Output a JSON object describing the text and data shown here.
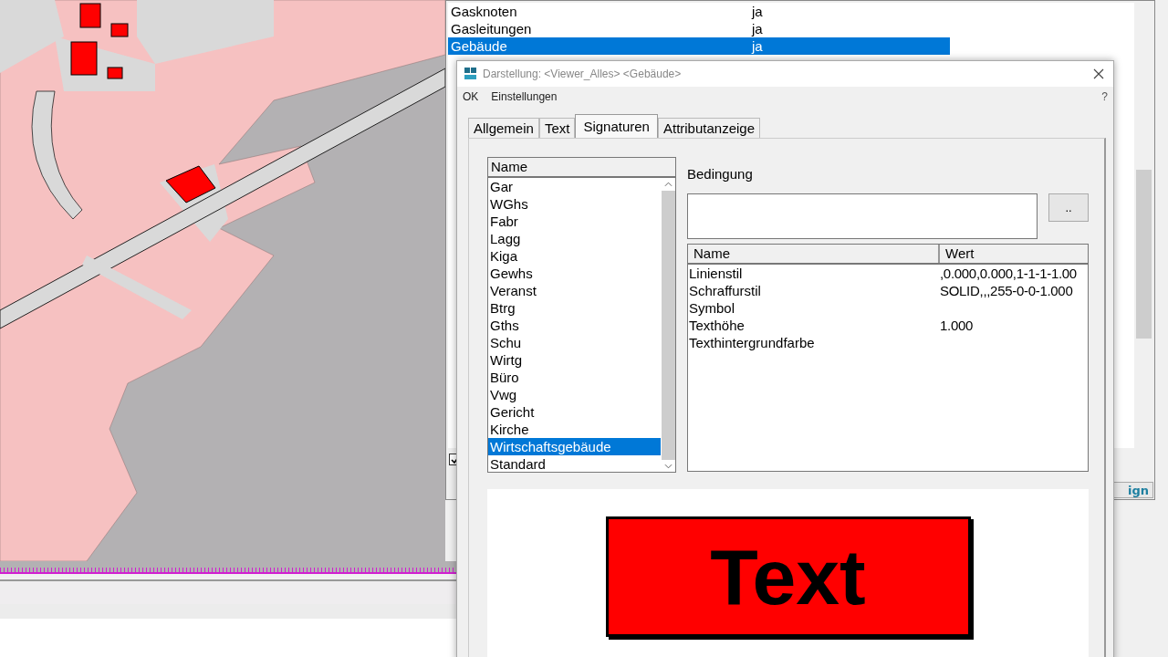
{
  "layer_list": {
    "rows": [
      {
        "name": "Gasknoten",
        "value": "ja",
        "selected": false
      },
      {
        "name": "Gasleitungen",
        "value": "ja",
        "selected": false
      },
      {
        "name": "Gebäude",
        "value": "ja",
        "selected": true
      }
    ],
    "checkbox": {
      "checked": true
    },
    "button_fragment": "ign"
  },
  "dialog": {
    "title": "Darstellung: <Viewer_Alles> <Gebäude>",
    "menu": [
      "OK",
      "Einstellungen"
    ],
    "help": "?",
    "tabs": [
      {
        "label": "Allgemein",
        "selected": false
      },
      {
        "label": "Text",
        "selected": false
      },
      {
        "label": "Signaturen",
        "selected": true
      },
      {
        "label": "Attributanzeige",
        "selected": false
      }
    ],
    "name_list": {
      "header": "Name",
      "items": [
        {
          "label": "Gar",
          "selected": false
        },
        {
          "label": "WGhs",
          "selected": false
        },
        {
          "label": "Fabr",
          "selected": false
        },
        {
          "label": "Lagg",
          "selected": false
        },
        {
          "label": "Kiga",
          "selected": false
        },
        {
          "label": "Gewhs",
          "selected": false
        },
        {
          "label": "Veranst",
          "selected": false
        },
        {
          "label": "Btrg",
          "selected": false
        },
        {
          "label": "Gths",
          "selected": false
        },
        {
          "label": "Schu",
          "selected": false
        },
        {
          "label": "Wirtg",
          "selected": false
        },
        {
          "label": "Büro",
          "selected": false
        },
        {
          "label": "Vwg",
          "selected": false
        },
        {
          "label": "Gericht",
          "selected": false
        },
        {
          "label": "Kirche",
          "selected": false
        },
        {
          "label": "Wirtschaftsgebäude",
          "selected": true
        },
        {
          "label": "Standard",
          "selected": false
        }
      ]
    },
    "condition_label": "Bedingung",
    "condition_button": "..",
    "properties": {
      "columns": [
        "Name",
        "Wert"
      ],
      "rows": [
        {
          "name": "Linienstil",
          "value": ",0.000,0.000,1-1-1-1.00"
        },
        {
          "name": "Schraffurstil",
          "value": "SOLID,,,255-0-0-1.000"
        },
        {
          "name": "Symbol"
        },
        {
          "name": "Texthöhe",
          "value": "1.000"
        },
        {
          "name": "Texthintergrundfarbe"
        }
      ]
    },
    "preview_text": "Text"
  }
}
